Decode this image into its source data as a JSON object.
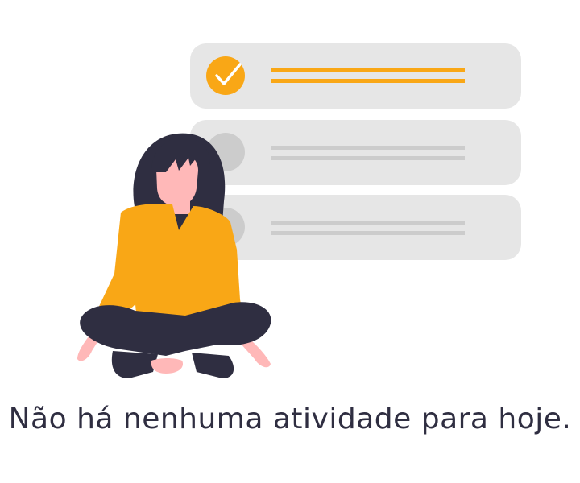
{
  "empty_state": {
    "message": "Não há nenhuma atividade para hoje.",
    "illustration_icon": "woman-meditating-checklist-icon",
    "task_cards": [
      {
        "status": "done",
        "check_icon": "check-icon"
      },
      {
        "status": "pending"
      },
      {
        "status": "pending"
      }
    ]
  },
  "colors": {
    "accent": "#f9a716",
    "card_background": "#e6e6e6",
    "pending_line": "#cccccc",
    "pending_circle": "#cccccc",
    "text": "#2f2e41",
    "skin": "#ffb8b8",
    "hair_and_pants": "#2f2e41"
  }
}
